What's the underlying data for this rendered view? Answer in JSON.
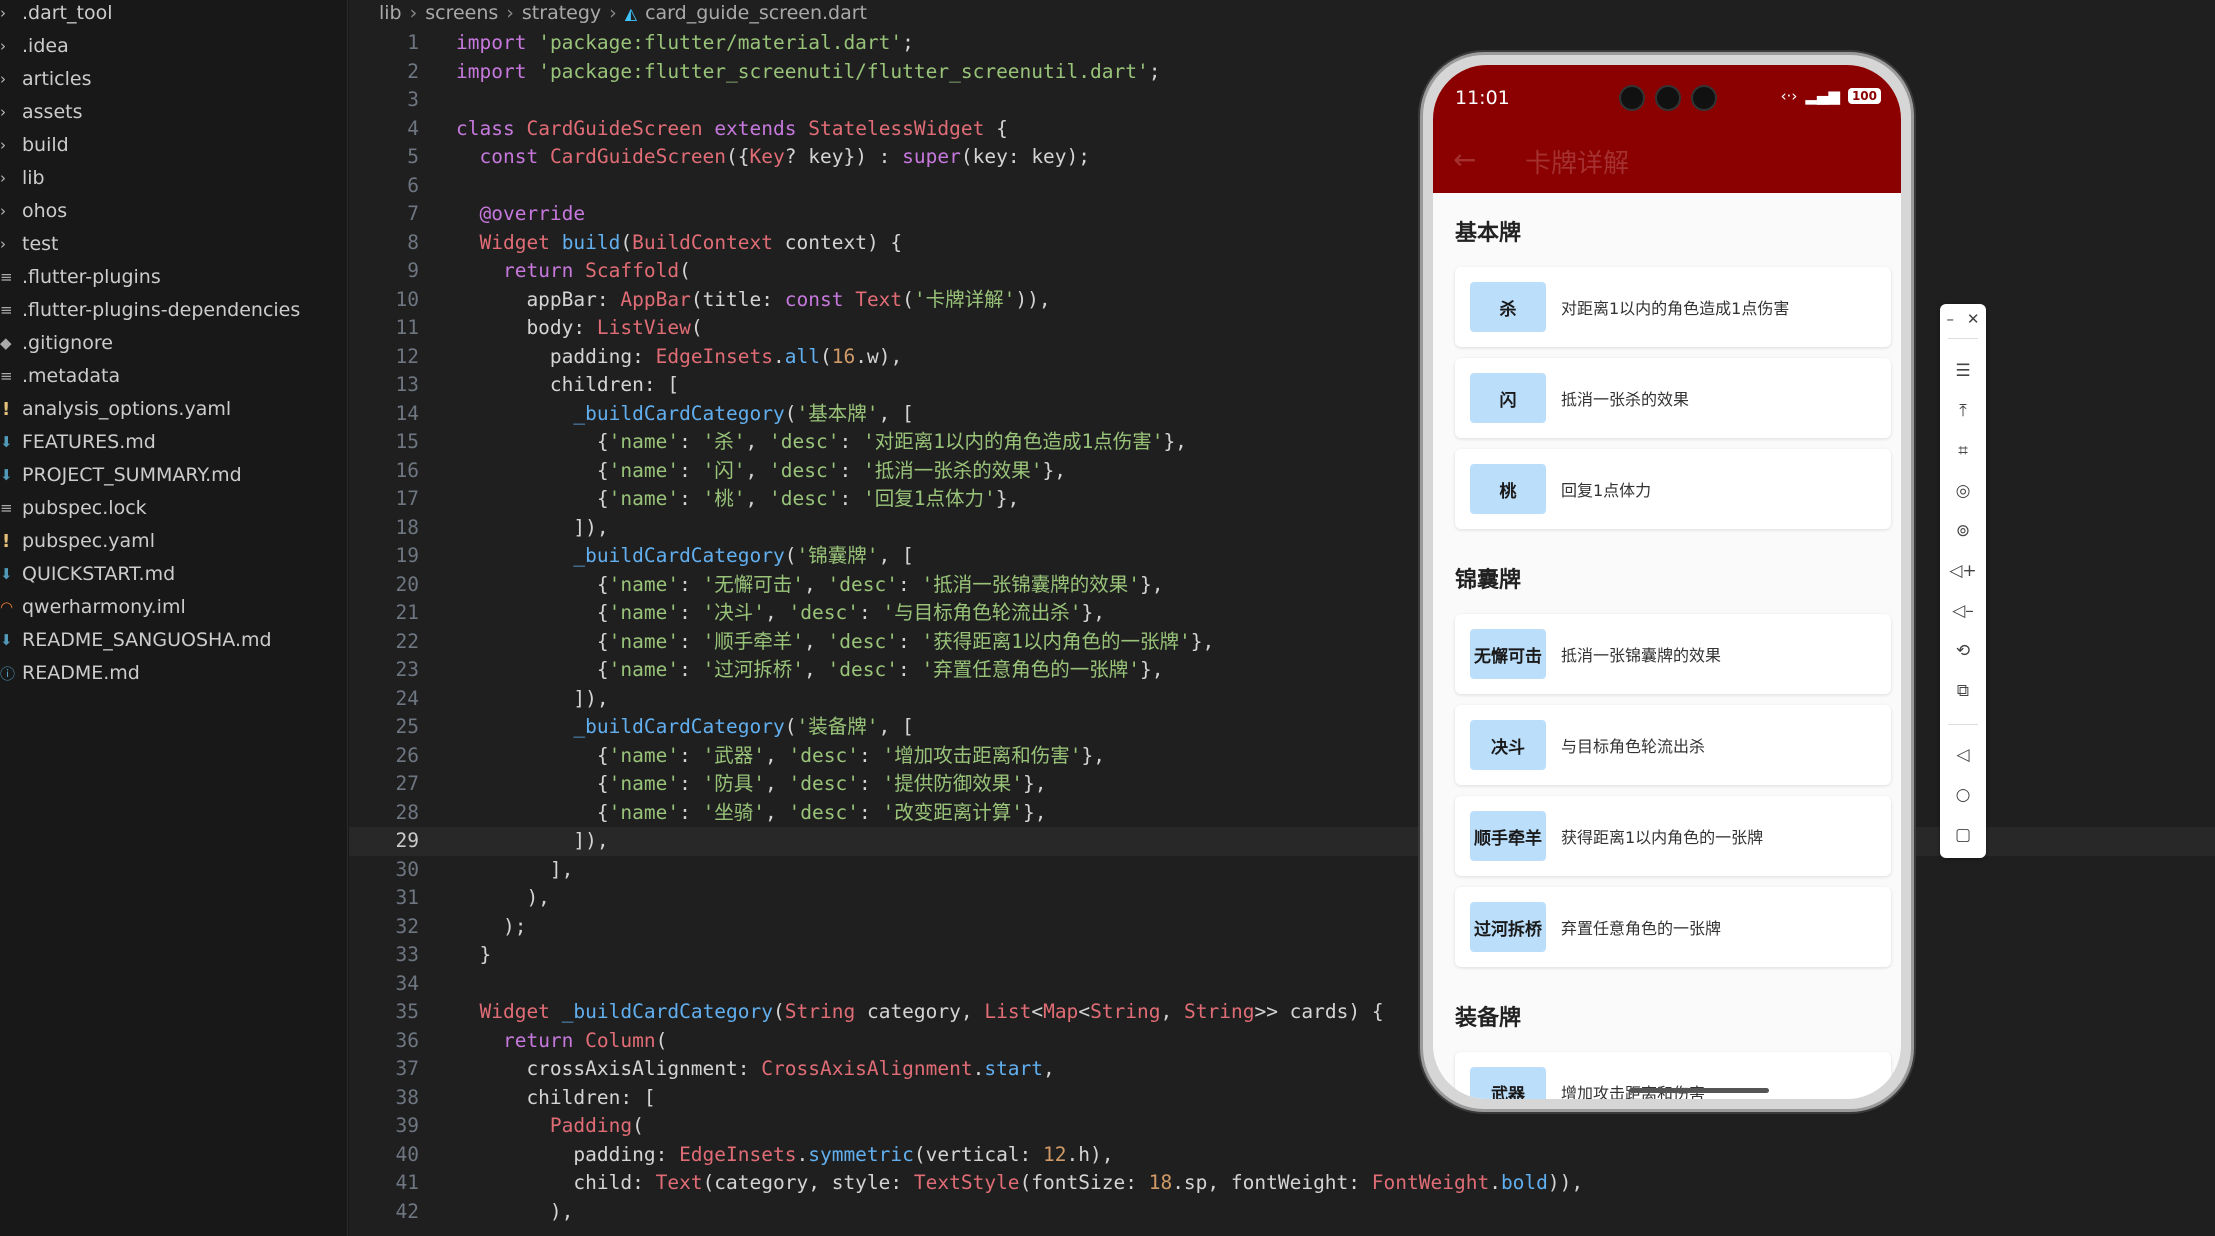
{
  "explorer": {
    "items": [
      {
        "icon": "chevron-right",
        "label": ".dart_tool"
      },
      {
        "icon": "chevron-right",
        "label": ".idea"
      },
      {
        "icon": "chevron-right",
        "label": "articles"
      },
      {
        "icon": "chevron-right",
        "label": "assets"
      },
      {
        "icon": "chevron-right",
        "label": "build"
      },
      {
        "icon": "chevron-right",
        "label": "lib"
      },
      {
        "icon": "chevron-right",
        "label": "ohos"
      },
      {
        "icon": "chevron-right",
        "label": "test"
      },
      {
        "icon": "lines",
        "label": ".flutter-plugins"
      },
      {
        "icon": "lines",
        "label": ".flutter-plugins-dependencies"
      },
      {
        "icon": "diamond",
        "label": ".gitignore"
      },
      {
        "icon": "lines",
        "label": ".metadata"
      },
      {
        "icon": "exclamation",
        "label": "analysis_options.yaml"
      },
      {
        "icon": "markdown",
        "label": "FEATURES.md"
      },
      {
        "icon": "markdown",
        "label": "PROJECT_SUMMARY.md"
      },
      {
        "icon": "lines",
        "label": "pubspec.lock"
      },
      {
        "icon": "exclamation",
        "label": "pubspec.yaml"
      },
      {
        "icon": "markdown",
        "label": "QUICKSTART.md"
      },
      {
        "icon": "rss",
        "label": "qwerharmony.iml"
      },
      {
        "icon": "markdown",
        "label": "README_SANGUOSHA.md"
      },
      {
        "icon": "info",
        "label": "README.md"
      }
    ]
  },
  "editor": {
    "breadcrumb": [
      "lib",
      "screens",
      "strategy",
      "card_guide_screen.dart"
    ],
    "current_line": 29,
    "lines": [
      {
        "n": "1",
        "t": "import 'package:flutter/material.dart';"
      },
      {
        "n": "2",
        "t": "import 'package:flutter_screenutil/flutter_screenutil.dart';"
      },
      {
        "n": "3",
        "t": ""
      },
      {
        "n": "4",
        "t": "class CardGuideScreen extends StatelessWidget {"
      },
      {
        "n": "5",
        "t": "  const CardGuideScreen({Key? key}) : super(key: key);"
      },
      {
        "n": "6",
        "t": ""
      },
      {
        "n": "7",
        "t": "  @override"
      },
      {
        "n": "8",
        "t": "  Widget build(BuildContext context) {"
      },
      {
        "n": "9",
        "t": "    return Scaffold("
      },
      {
        "n": "10",
        "t": "      appBar: AppBar(title: const Text('卡牌详解')),"
      },
      {
        "n": "11",
        "t": "      body: ListView("
      },
      {
        "n": "12",
        "t": "        padding: EdgeInsets.all(16.w),"
      },
      {
        "n": "13",
        "t": "        children: ["
      },
      {
        "n": "14",
        "t": "          _buildCardCategory('基本牌', ["
      },
      {
        "n": "15",
        "t": "            {'name': '杀', 'desc': '对距离1以内的角色造成1点伤害'},"
      },
      {
        "n": "16",
        "t": "            {'name': '闪', 'desc': '抵消一张杀的效果'},"
      },
      {
        "n": "17",
        "t": "            {'name': '桃', 'desc': '回复1点体力'},"
      },
      {
        "n": "18",
        "t": "          ]),"
      },
      {
        "n": "19",
        "t": "          _buildCardCategory('锦囊牌', ["
      },
      {
        "n": "20",
        "t": "            {'name': '无懈可击', 'desc': '抵消一张锦囊牌的效果'},"
      },
      {
        "n": "21",
        "t": "            {'name': '决斗', 'desc': '与目标角色轮流出杀'},"
      },
      {
        "n": "22",
        "t": "            {'name': '顺手牵羊', 'desc': '获得距离1以内角色的一张牌'},"
      },
      {
        "n": "23",
        "t": "            {'name': '过河拆桥', 'desc': '弃置任意角色的一张牌'},"
      },
      {
        "n": "24",
        "t": "          ]),"
      },
      {
        "n": "25",
        "t": "          _buildCardCategory('装备牌', ["
      },
      {
        "n": "26",
        "t": "            {'name': '武器', 'desc': '增加攻击距离和伤害'},"
      },
      {
        "n": "27",
        "t": "            {'name': '防具', 'desc': '提供防御效果'},"
      },
      {
        "n": "28",
        "t": "            {'name': '坐骑', 'desc': '改变距离计算'},"
      },
      {
        "n": "29",
        "t": "          ]),"
      },
      {
        "n": "30",
        "t": "        ],"
      },
      {
        "n": "31",
        "t": "      ),"
      },
      {
        "n": "32",
        "t": "    );"
      },
      {
        "n": "33",
        "t": "  }"
      },
      {
        "n": "34",
        "t": ""
      },
      {
        "n": "35",
        "t": "  Widget _buildCardCategory(String category, List<Map<String, String>> cards) {"
      },
      {
        "n": "36",
        "t": "    return Column("
      },
      {
        "n": "37",
        "t": "      crossAxisAlignment: CrossAxisAlignment.start,"
      },
      {
        "n": "38",
        "t": "      children: ["
      },
      {
        "n": "39",
        "t": "        Padding("
      },
      {
        "n": "40",
        "t": "          padding: EdgeInsets.symmetric(vertical: 12.h),"
      },
      {
        "n": "41",
        "t": "          child: Text(category, style: TextStyle(fontSize: 18.sp, fontWeight: FontWeight.bold)),"
      },
      {
        "n": "42",
        "t": "        ),"
      }
    ]
  },
  "phone": {
    "status": {
      "time": "11:01",
      "battery": "100"
    },
    "appbar": {
      "title": "卡牌详解",
      "color": "#8b0000"
    },
    "categories": [
      {
        "title": "基本牌",
        "cards": [
          {
            "name": "杀",
            "desc": "对距离1以内的角色造成1点伤害"
          },
          {
            "name": "闪",
            "desc": "抵消一张杀的效果"
          },
          {
            "name": "桃",
            "desc": "回复1点体力"
          }
        ]
      },
      {
        "title": "锦囊牌",
        "cards": [
          {
            "name": "无懈可击",
            "desc": "抵消一张锦囊牌的效果"
          },
          {
            "name": "决斗",
            "desc": "与目标角色轮流出杀"
          },
          {
            "name": "顺手牵羊",
            "desc": "获得距离1以内角色的一张牌"
          },
          {
            "name": "过河拆桥",
            "desc": "弃置任意角色的一张牌"
          }
        ]
      },
      {
        "title": "装备牌",
        "cards": [
          {
            "name": "武器",
            "desc": "增加攻击距离和伤害"
          }
        ]
      }
    ],
    "badge_color": "#bbdefb"
  },
  "emulator_toolbar": {
    "buttons": [
      "menu-icon",
      "pin-top-icon",
      "crop-icon",
      "rotate-icon",
      "screenshot-icon",
      "volume-up-icon",
      "volume-down-icon",
      "shake-icon",
      "multi-window-icon",
      "back-nav-icon",
      "home-nav-icon",
      "recents-nav-icon"
    ]
  }
}
